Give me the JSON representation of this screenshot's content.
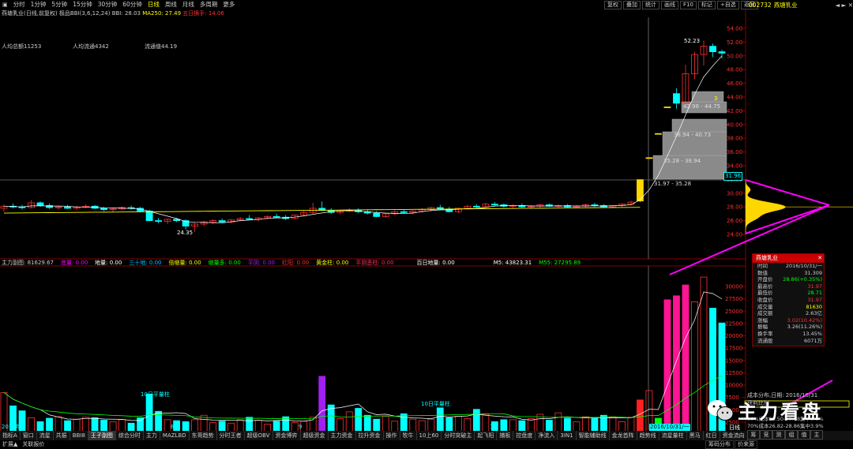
{
  "periods": [
    "分时",
    "1分钟",
    "5分钟",
    "15分钟",
    "30分钟",
    "60分钟",
    "日线",
    "周线",
    "月线",
    "多周期",
    "更多"
  ],
  "selected_period": "日线",
  "toolbar_right": [
    "复权",
    "叠加",
    "统计",
    "画线",
    "F10",
    "标记",
    "+自选",
    "返回"
  ],
  "stock_code": "002732",
  "stock_name": "燕塘乳业",
  "chart_header": {
    "name": "燕塘乳业(日线,前复权)",
    "indicator": "极品BBI(3,6,12,24)",
    "bbi": "BBI: 28.03",
    "ma250": "MA250: 27.49",
    "turnover5": "五日换手: 14.06"
  },
  "stats": {
    "avg_total": "人均总额11253",
    "avg_float": "人均流通4342",
    "float_value": "流通值44.19"
  },
  "chip_labels": [
    "31.97 - 35.28",
    "35.28 - 38.94",
    "38.94 - 40.73",
    "42.96 - 44.75"
  ],
  "chip_num": "3",
  "high_label": "52.23",
  "low_label": "24.35",
  "price_marker": "31.96",
  "price_axis": [
    "54.00",
    "52.00",
    "50.00",
    "48.00",
    "46.00",
    "44.00",
    "42.00",
    "40.00",
    "38.00",
    "36.00",
    "34.00",
    "32.00",
    "30.00",
    "28.00",
    "26.00",
    "24.00"
  ],
  "vol_axis": [
    "30000",
    "27500",
    "25000",
    "22500",
    "20000",
    "17500",
    "15000",
    "12500",
    "10000",
    "7500",
    "5000",
    "2500"
  ],
  "subchart": {
    "title": "主力副图",
    "value": ": 81629.67",
    "labels": [
      {
        "t": "底量: 0.00",
        "c": "#ff00ff"
      },
      {
        "t": "地量: 0.00",
        "c": "#fff"
      },
      {
        "t": "三十地: 0.00",
        "c": "#00bfff"
      },
      {
        "t": "倍缩量: 0.00",
        "c": "#ff0"
      },
      {
        "t": "缩量多: 0.00",
        "c": "#0f0"
      },
      {
        "t": "平阴: 0.00",
        "c": "#a020f0"
      },
      {
        "t": "红阳: 0.00",
        "c": "#ff3030"
      },
      {
        "t": "黄金柱: 0.00",
        "c": "#ff0"
      },
      {
        "t": "平阴恶柱: 0.00",
        "c": "#ff3060"
      }
    ],
    "hundred": "百日地量: 0.00",
    "m5": "M5: 43823.31",
    "m55": "M55: 27295.89"
  },
  "vol_annot": [
    "10日平量柱",
    "10日平量柱"
  ],
  "date_axis": [
    "2016年",
    "8",
    "9",
    "10",
    "2016/10/31/一",
    "日线"
  ],
  "info_panel": {
    "title": "燕塘乳业",
    "rows": [
      {
        "k": "时间",
        "v": "2016/10/31/一",
        "c": "#ccc"
      },
      {
        "k": "数值",
        "v": "31.309",
        "c": "#ccc"
      },
      {
        "k": "开盘价",
        "v": "28.86(+0.35%)",
        "c": "#0f0"
      },
      {
        "k": "最高价",
        "v": "31.97",
        "c": "#f33"
      },
      {
        "k": "最低价",
        "v": "28.71",
        "c": "#0f0"
      },
      {
        "k": "收盘价",
        "v": "31.97",
        "c": "#f33"
      },
      {
        "k": "成交量",
        "v": "81630",
        "c": "#ff0"
      },
      {
        "k": "成交额",
        "v": "2.63亿",
        "c": "#ccc"
      },
      {
        "k": "涨幅",
        "v": "3.02(10.42%)",
        "c": "#f33"
      },
      {
        "k": "振幅",
        "v": "3.26(11.26%)",
        "c": "#ccc"
      },
      {
        "k": "换手率",
        "v": "13.45%",
        "c": "#ccc"
      },
      {
        "k": "流通股",
        "v": "6071万",
        "c": "#ccc"
      }
    ]
  },
  "cost_lines": [
    "成本分布,日期: 2016/10/31",
    "获利比例",
    "90%成本25.50-30.48集中9.5%",
    "70%成本26.82-28.86集中3.9%"
  ],
  "watermark": "主力看盘",
  "tabs": [
    "指标A",
    "窗口",
    "流星",
    "共振",
    "BBI8",
    "王子副图",
    "综合分时",
    "主力",
    "MAZLBD",
    "东哥趋势",
    "分时王者",
    "超级OBV",
    "资金博弈",
    "超级资金",
    "主力资金",
    "拉升资金",
    "操作",
    "牧牛",
    "10上60",
    "分时突破主",
    "起飞阳",
    "捕板",
    "控盘度",
    "净流入",
    "3IN1",
    "智能辅助线",
    "金龙首阵",
    "趋势线",
    "流星量柱",
    "黑马",
    "红日",
    "资金流向"
  ],
  "active_tab": "王子副图",
  "tabs2": [
    "扩展▲",
    "关联报价"
  ],
  "bottom_right": [
    "筹码分布",
    "价来源"
  ],
  "right_buttons": [
    "筹",
    "竞",
    "测",
    "组",
    "值",
    "主"
  ]
}
